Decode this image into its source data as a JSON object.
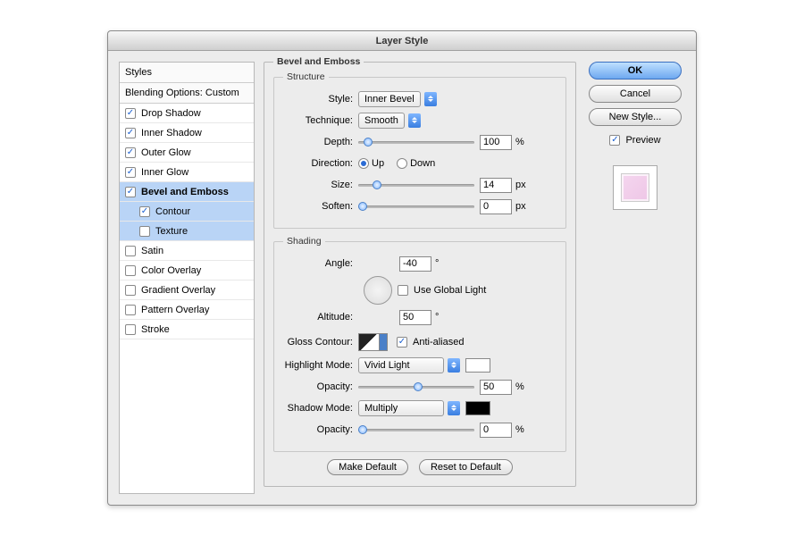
{
  "title": "Layer Style",
  "sidebar": {
    "header": "Styles",
    "blending": "Blending Options: Custom",
    "items": [
      {
        "label": "Drop Shadow",
        "checked": true
      },
      {
        "label": "Inner Shadow",
        "checked": true
      },
      {
        "label": "Outer Glow",
        "checked": true
      },
      {
        "label": "Inner Glow",
        "checked": true
      },
      {
        "label": "Bevel and Emboss",
        "checked": true
      },
      {
        "label": "Contour",
        "checked": true
      },
      {
        "label": "Texture",
        "checked": false
      },
      {
        "label": "Satin",
        "checked": false
      },
      {
        "label": "Color Overlay",
        "checked": false
      },
      {
        "label": "Gradient Overlay",
        "checked": false
      },
      {
        "label": "Pattern Overlay",
        "checked": false
      },
      {
        "label": "Stroke",
        "checked": false
      }
    ]
  },
  "panel": {
    "title": "Bevel and Emboss",
    "structure": {
      "legend": "Structure",
      "style_label": "Style:",
      "style_value": "Inner Bevel",
      "technique_label": "Technique:",
      "technique_value": "Smooth",
      "depth_label": "Depth:",
      "depth_value": "100",
      "depth_unit": "%",
      "direction_label": "Direction:",
      "up": "Up",
      "down": "Down",
      "size_label": "Size:",
      "size_value": "14",
      "size_unit": "px",
      "soften_label": "Soften:",
      "soften_value": "0",
      "soften_unit": "px"
    },
    "shading": {
      "legend": "Shading",
      "angle_label": "Angle:",
      "angle_value": "-40",
      "angle_unit": "°",
      "global": "Use Global Light",
      "altitude_label": "Altitude:",
      "altitude_value": "50",
      "altitude_unit": "°",
      "gloss_label": "Gloss Contour:",
      "aa": "Anti-aliased",
      "highlight_label": "Highlight Mode:",
      "highlight_value": "Vivid Light",
      "hopacity_label": "Opacity:",
      "hopacity_value": "50",
      "hopacity_unit": "%",
      "shadow_label": "Shadow Mode:",
      "shadow_value": "Multiply",
      "sopacity_label": "Opacity:",
      "sopacity_value": "0",
      "sopacity_unit": "%"
    },
    "make_default": "Make Default",
    "reset_default": "Reset to Default"
  },
  "buttons": {
    "ok": "OK",
    "cancel": "Cancel",
    "new_style": "New Style...",
    "preview": "Preview"
  }
}
